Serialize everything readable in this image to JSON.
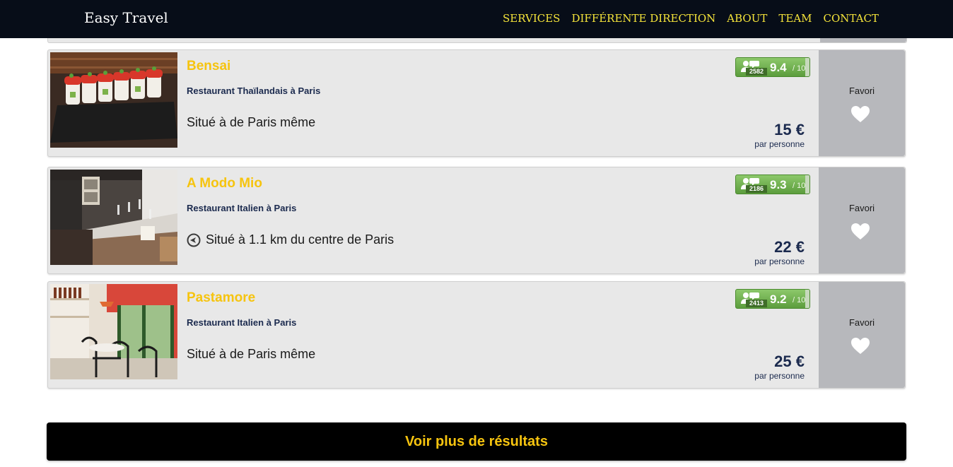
{
  "navbar": {
    "brand": "Easy Travel",
    "links": [
      "SERVICES",
      "DIFFÉRENTE DIRECTION",
      "ABOUT",
      "TEAM",
      "CONTACT"
    ]
  },
  "results": [
    {
      "name": "Bensai",
      "type": "Restaurant Thaïlandais à Paris",
      "location": "Situé à de Paris même",
      "has_location_icon": false,
      "review_count": "2582",
      "score": "9.4",
      "score_max": "/ 10",
      "price": "15 €",
      "price_note": "par personne",
      "favorite_label": "Favori"
    },
    {
      "name": "A Modo Mio",
      "type": "Restaurant Italien à Paris",
      "location": "Situé à 1.1 km du centre de Paris",
      "has_location_icon": true,
      "review_count": "2186",
      "score": "9.3",
      "score_max": "/ 10",
      "price": "22 €",
      "price_note": "par personne",
      "favorite_label": "Favori"
    },
    {
      "name": "Pastamore",
      "type": "Restaurant Italien à Paris",
      "location": "Situé à de Paris même",
      "has_location_icon": false,
      "review_count": "2413",
      "score": "9.2",
      "score_max": "/ 10",
      "price": "25 €",
      "price_note": "par personne",
      "favorite_label": "Favori"
    }
  ],
  "more_button": "Voir plus de résultats",
  "colors": {
    "navbar_bg": "#070d18",
    "nav_link": "#f5e43a",
    "accent_yellow": "#f6c40f",
    "navy_text": "#1b2a4e",
    "rating_green": "#6aab47",
    "favorite_bg": "#b7b8bc"
  }
}
